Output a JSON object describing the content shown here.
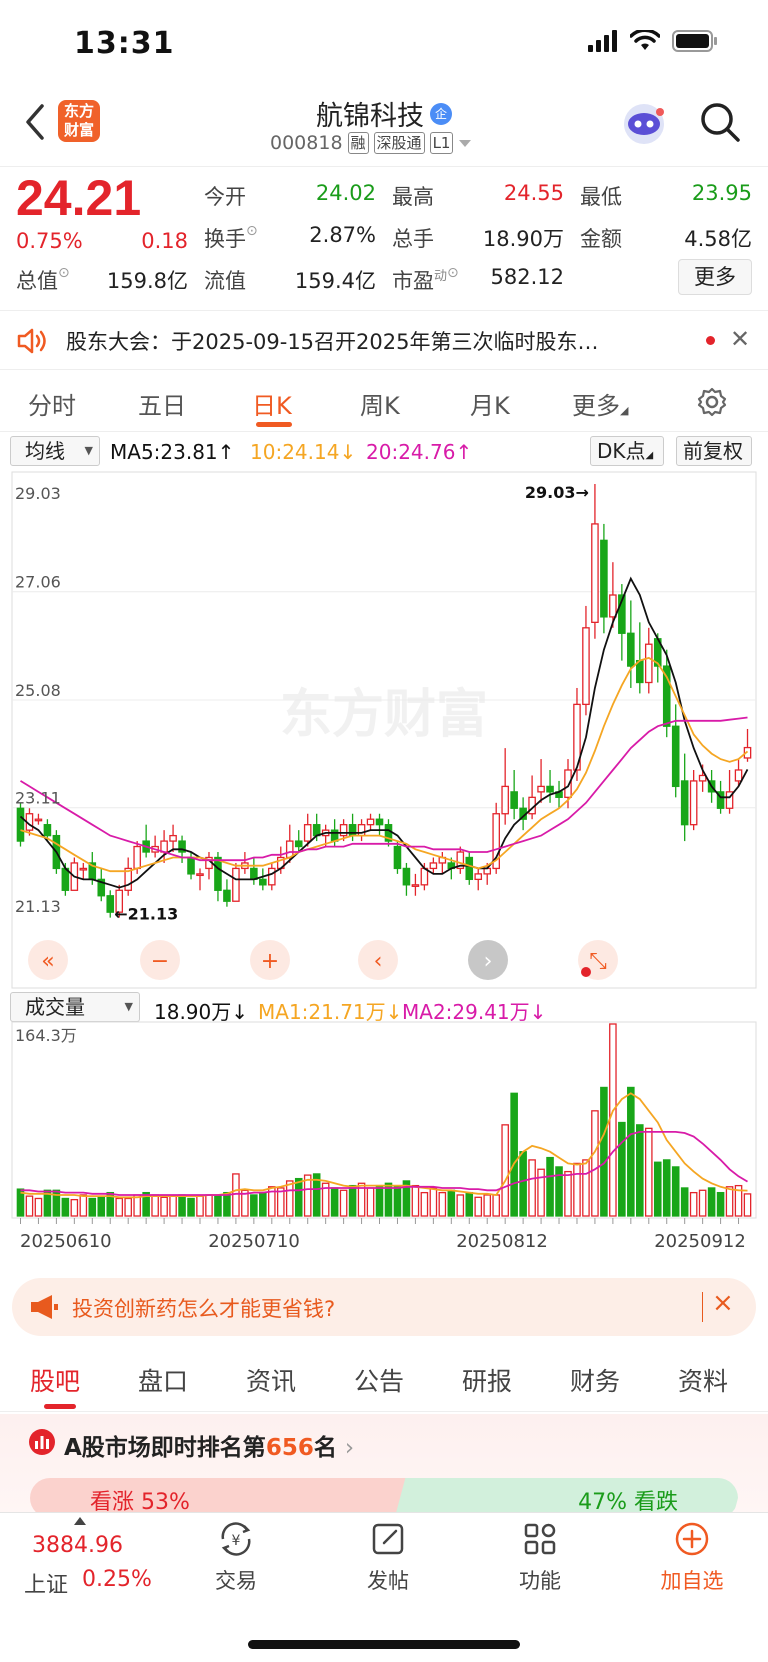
{
  "status": {
    "time": "13:31"
  },
  "header": {
    "logo_text": "东方\n财富",
    "stock_name": "航锦科技",
    "name_badge": "企",
    "code": "000818",
    "tags": [
      "融",
      "深股通",
      "L1"
    ]
  },
  "quote": {
    "price": "24.21",
    "change_pct": "0.75%",
    "change_amt": "0.18",
    "fields": [
      {
        "label": "今开",
        "value": "24.02",
        "color": "#1a9c1a"
      },
      {
        "label": "最高",
        "value": "24.55",
        "color": "#e3242b"
      },
      {
        "label": "最低",
        "value": "23.95",
        "color": "#1a9c1a"
      },
      {
        "label": "换手",
        "value": "2.87%",
        "color": "#222222"
      },
      {
        "label": "总手",
        "value": "18.90万",
        "color": "#222222"
      },
      {
        "label": "金额",
        "value": "4.58亿",
        "color": "#222222"
      },
      {
        "label": "总值",
        "value": "159.8亿",
        "color": "#222222"
      },
      {
        "label": "流值",
        "value": "159.4亿",
        "color": "#222222"
      },
      {
        "label": "市盈",
        "label_sup": "动",
        "value": "582.12",
        "color": "#222222"
      }
    ],
    "more_label": "更多"
  },
  "notice": {
    "text": "股东大会：于2025-09-15召开2025年第三次临时股东…"
  },
  "period_tabs": [
    "分时",
    "五日",
    "日K",
    "周K",
    "月K",
    "更多"
  ],
  "active_period": "日K",
  "ma_bar": {
    "selector": "均线",
    "ma5": "MA5:23.81",
    "ma10": "10:24.14",
    "ma20": "20:24.76",
    "dk_label": "DK点",
    "adjust_label": "前复权"
  },
  "watermark": "东方财富",
  "chart_data": [
    {
      "type": "candlestick",
      "y_ticks": [
        "29.03",
        "27.06",
        "25.08",
        "23.11",
        "21.13"
      ],
      "ylim": [
        21.13,
        29.03
      ],
      "max_label": "29.03",
      "min_label": "21.13",
      "candles": [
        [
          23.1,
          22.5,
          23.2,
          22.4
        ],
        [
          22.7,
          23.0,
          23.1,
          22.6
        ],
        [
          22.9,
          22.9,
          23.0,
          22.8
        ],
        [
          22.8,
          22.6,
          22.9,
          22.5
        ],
        [
          22.6,
          22.0,
          22.7,
          21.9
        ],
        [
          22.0,
          21.6,
          22.1,
          21.5
        ],
        [
          21.6,
          22.1,
          22.2,
          21.6
        ],
        [
          22.0,
          22.0,
          22.1,
          21.8
        ],
        [
          22.1,
          21.8,
          22.3,
          21.7
        ],
        [
          21.8,
          21.5,
          22.0,
          21.4
        ],
        [
          21.5,
          21.2,
          21.6,
          21.1
        ],
        [
          21.2,
          21.6,
          21.7,
          21.1
        ],
        [
          21.6,
          22.0,
          22.2,
          21.5
        ],
        [
          22.0,
          22.4,
          22.5,
          21.9
        ],
        [
          22.5,
          22.3,
          22.8,
          22.2
        ],
        [
          22.3,
          22.4,
          22.6,
          22.2
        ],
        [
          22.3,
          22.5,
          22.7,
          22.1
        ],
        [
          22.5,
          22.6,
          22.8,
          22.3
        ],
        [
          22.5,
          22.3,
          22.6,
          22.1
        ],
        [
          22.2,
          21.9,
          22.3,
          21.8
        ],
        [
          21.9,
          21.9,
          22.0,
          21.6
        ],
        [
          22.0,
          22.2,
          22.3,
          21.8
        ],
        [
          22.2,
          21.6,
          22.3,
          21.4
        ],
        [
          21.6,
          21.4,
          21.8,
          21.3
        ],
        [
          21.4,
          22.0,
          22.1,
          21.4
        ],
        [
          22.0,
          22.1,
          22.3,
          21.9
        ],
        [
          22.0,
          21.8,
          22.2,
          21.7
        ],
        [
          21.8,
          21.7,
          22.0,
          21.6
        ],
        [
          21.7,
          22.0,
          22.1,
          21.6
        ],
        [
          22.0,
          22.2,
          22.4,
          21.9
        ],
        [
          22.2,
          22.5,
          22.8,
          22.1
        ],
        [
          22.5,
          22.4,
          22.7,
          22.3
        ],
        [
          22.5,
          22.8,
          23.0,
          22.4
        ],
        [
          22.8,
          22.6,
          23.0,
          22.5
        ],
        [
          22.6,
          22.7,
          22.8,
          22.4
        ],
        [
          22.7,
          22.5,
          22.9,
          22.4
        ],
        [
          22.6,
          22.8,
          22.9,
          22.5
        ],
        [
          22.8,
          22.6,
          23.0,
          22.5
        ],
        [
          22.6,
          22.8,
          22.9,
          22.5
        ],
        [
          22.8,
          22.9,
          23.0,
          22.7
        ],
        [
          22.9,
          22.8,
          23.0,
          22.6
        ],
        [
          22.8,
          22.5,
          22.9,
          22.4
        ],
        [
          22.4,
          22.0,
          22.5,
          21.9
        ],
        [
          22.0,
          21.7,
          22.1,
          21.5
        ],
        [
          21.7,
          21.7,
          21.9,
          21.5
        ],
        [
          21.7,
          22.0,
          22.1,
          21.6
        ],
        [
          22.0,
          22.1,
          22.2,
          21.9
        ],
        [
          22.1,
          22.2,
          22.3,
          21.9
        ],
        [
          22.1,
          22.0,
          22.2,
          21.8
        ],
        [
          22.0,
          22.3,
          22.4,
          21.9
        ],
        [
          22.2,
          21.8,
          22.3,
          21.7
        ],
        [
          21.8,
          21.9,
          22.0,
          21.6
        ],
        [
          21.9,
          22.0,
          22.1,
          21.7
        ],
        [
          22.0,
          23.0,
          23.2,
          21.9
        ],
        [
          23.0,
          23.5,
          24.2,
          22.8
        ],
        [
          23.4,
          23.1,
          23.8,
          22.9
        ],
        [
          23.1,
          22.9,
          23.3,
          22.7
        ],
        [
          23.0,
          23.3,
          23.7,
          22.9
        ],
        [
          23.4,
          23.5,
          24.0,
          23.2
        ],
        [
          23.5,
          23.4,
          23.8,
          23.2
        ],
        [
          23.4,
          23.3,
          23.6,
          23.1
        ],
        [
          23.3,
          23.8,
          24.0,
          23.1
        ],
        [
          23.8,
          25.0,
          25.3,
          23.6
        ],
        [
          25.0,
          26.4,
          26.8,
          24.8
        ],
        [
          26.5,
          28.3,
          29.03,
          26.2
        ],
        [
          28.0,
          26.6,
          28.3,
          26.3
        ],
        [
          26.6,
          27.0,
          27.6,
          26.4
        ],
        [
          27.0,
          26.3,
          27.2,
          25.8
        ],
        [
          26.3,
          25.7,
          26.9,
          25.3
        ],
        [
          25.8,
          25.4,
          26.5,
          25.2
        ],
        [
          25.4,
          26.1,
          26.4,
          25.2
        ],
        [
          26.2,
          25.7,
          26.3,
          25.4
        ],
        [
          25.7,
          24.6,
          26.0,
          24.4
        ],
        [
          24.6,
          23.5,
          25.0,
          23.3
        ],
        [
          23.6,
          22.8,
          24.1,
          22.5
        ],
        [
          22.8,
          23.6,
          23.8,
          22.7
        ],
        [
          23.6,
          23.7,
          23.9,
          23.4
        ],
        [
          23.6,
          23.4,
          23.8,
          23.2
        ],
        [
          23.4,
          23.1,
          23.6,
          23.0
        ],
        [
          23.1,
          23.4,
          23.8,
          23.0
        ],
        [
          23.6,
          23.8,
          24.0,
          23.5
        ],
        [
          24.02,
          24.21,
          24.55,
          23.95
        ]
      ],
      "ma5": [
        22.95,
        22.8,
        22.7,
        22.5,
        22.3,
        22.0,
        21.85,
        21.8,
        21.8,
        21.75,
        21.7,
        21.65,
        21.7,
        21.8,
        21.95,
        22.1,
        22.25,
        22.35,
        22.35,
        22.3,
        22.2,
        22.15,
        22.0,
        21.9,
        21.8,
        21.8,
        21.8,
        21.85,
        21.9,
        22.0,
        22.15,
        22.3,
        22.45,
        22.6,
        22.65,
        22.65,
        22.65,
        22.65,
        22.65,
        22.7,
        22.7,
        22.7,
        22.6,
        22.4,
        22.2,
        22.0,
        21.9,
        21.9,
        22.0,
        22.05,
        22.05,
        22.0,
        22.0,
        22.2,
        22.55,
        22.8,
        22.95,
        23.1,
        23.25,
        23.35,
        23.4,
        23.5,
        23.85,
        24.4,
        25.3,
        26.0,
        26.5,
        26.9,
        27.3,
        27.0,
        26.5,
        26.2,
        25.9,
        25.4,
        24.7,
        24.2,
        23.8,
        23.5,
        23.3,
        23.3,
        23.5,
        23.81
      ],
      "ma10": [
        22.7,
        22.65,
        22.6,
        22.55,
        22.45,
        22.35,
        22.25,
        22.15,
        22.05,
        22.0,
        21.95,
        21.95,
        21.95,
        22.0,
        22.05,
        22.1,
        22.15,
        22.2,
        22.2,
        22.2,
        22.2,
        22.15,
        22.15,
        22.1,
        22.05,
        22.05,
        22.05,
        22.05,
        22.1,
        22.15,
        22.2,
        22.3,
        22.35,
        22.4,
        22.45,
        22.5,
        22.55,
        22.6,
        22.6,
        22.6,
        22.6,
        22.55,
        22.5,
        22.45,
        22.35,
        22.3,
        22.25,
        22.2,
        22.15,
        22.1,
        22.05,
        22.0,
        22.05,
        22.15,
        22.3,
        22.45,
        22.6,
        22.75,
        22.9,
        23.0,
        23.1,
        23.25,
        23.45,
        23.75,
        24.15,
        24.6,
        25.0,
        25.35,
        25.65,
        25.8,
        25.85,
        25.75,
        25.5,
        25.15,
        24.8,
        24.45,
        24.25,
        24.1,
        24.0,
        23.95,
        24.0,
        24.14
      ],
      "ma20": [
        23.6,
        23.5,
        23.4,
        23.3,
        23.2,
        23.1,
        23.0,
        22.9,
        22.8,
        22.7,
        22.6,
        22.55,
        22.5,
        22.45,
        22.4,
        22.35,
        22.3,
        22.25,
        22.2,
        22.2,
        22.15,
        22.15,
        22.15,
        22.15,
        22.15,
        22.15,
        22.2,
        22.2,
        22.25,
        22.25,
        22.3,
        22.3,
        22.35,
        22.35,
        22.4,
        22.4,
        22.4,
        22.45,
        22.45,
        22.45,
        22.45,
        22.45,
        22.45,
        22.4,
        22.4,
        22.4,
        22.35,
        22.35,
        22.35,
        22.35,
        22.3,
        22.3,
        22.3,
        22.35,
        22.4,
        22.45,
        22.5,
        22.55,
        22.6,
        22.7,
        22.8,
        22.9,
        23.05,
        23.2,
        23.4,
        23.6,
        23.8,
        24.0,
        24.2,
        24.35,
        24.5,
        24.6,
        24.65,
        24.7,
        24.7,
        24.7,
        24.7,
        24.7,
        24.7,
        24.72,
        24.74,
        24.76
      ]
    },
    {
      "type": "bar",
      "title": "成交量",
      "last_vol": "18.90万",
      "ma1": "MA1:21.71万",
      "ma2": "MA2:29.41万",
      "y_max_label": "164.3万",
      "ylim": [
        0,
        164.3
      ],
      "x_labels": [
        "20250610",
        "20250710",
        "20250812",
        "20250912"
      ],
      "volumes": [
        23,
        17,
        15,
        22,
        22,
        15,
        14,
        18,
        15,
        16,
        20,
        15,
        15,
        18,
        20,
        18,
        16,
        17,
        18,
        15,
        17,
        18,
        17,
        20,
        36,
        22,
        18,
        20,
        25,
        24,
        30,
        32,
        35,
        36,
        28,
        24,
        22,
        26,
        28,
        24,
        26,
        28,
        25,
        30,
        26,
        20,
        24,
        20,
        22,
        18,
        20,
        16,
        18,
        18,
        78,
        105,
        55,
        48,
        40,
        50,
        42,
        38,
        45,
        48,
        90,
        110,
        164.3,
        80,
        110,
        78,
        75,
        46,
        48,
        42,
        24,
        20,
        22,
        24,
        20,
        25,
        26,
        18.9
      ],
      "vol_ma1": [
        20,
        19,
        19,
        19,
        18,
        18,
        18,
        17,
        17,
        17,
        17,
        16,
        16,
        16,
        17,
        17,
        17,
        17,
        17,
        17,
        17,
        18,
        18,
        19,
        22,
        23,
        22,
        22,
        24,
        25,
        27,
        29,
        31,
        31,
        30,
        28,
        26,
        25,
        26,
        26,
        26,
        26,
        26,
        26,
        25,
        24,
        23,
        22,
        22,
        21,
        20,
        19,
        19,
        18,
        30,
        45,
        55,
        60,
        58,
        55,
        50,
        45,
        44,
        45,
        55,
        70,
        90,
        100,
        105,
        100,
        90,
        80,
        65,
        55,
        45,
        38,
        32,
        28,
        25,
        23,
        22,
        21.71
      ],
      "vol_ma2": [
        22,
        22,
        21,
        21,
        21,
        20,
        20,
        20,
        19,
        19,
        19,
        18,
        18,
        18,
        18,
        18,
        18,
        18,
        18,
        18,
        18,
        18,
        18,
        18,
        19,
        19,
        20,
        20,
        21,
        21,
        22,
        22,
        23,
        23,
        24,
        24,
        24,
        24,
        24,
        24,
        24,
        24,
        24,
        25,
        25,
        25,
        25,
        24,
        24,
        24,
        23,
        23,
        22,
        22,
        25,
        28,
        30,
        32,
        33,
        34,
        35,
        35,
        36,
        36,
        40,
        45,
        55,
        63,
        70,
        72,
        72,
        72,
        72,
        72,
        71,
        68,
        62,
        55,
        48,
        40,
        34,
        29.41
      ],
      "up_color": "#e3242b",
      "down_color": "#19a619"
    }
  ],
  "chart_controls": [
    "«",
    "−",
    "+",
    "‹",
    "›",
    "⤡"
  ],
  "ad": {
    "text": "投资创新药怎么才能更省钱?",
    "close": "×"
  },
  "section_tabs": [
    "股吧",
    "盘口",
    "资讯",
    "公告",
    "研报",
    "财务",
    "资料"
  ],
  "active_section": "股吧",
  "ranking": {
    "prefix": "A股市场即时排名第",
    "rank": "656",
    "suffix": "名",
    "left_text": "看涨 53%",
    "right_text": "47% 看跌"
  },
  "bottom": {
    "index_value": "3884.96",
    "index_name": "上证",
    "index_change": "0.25%",
    "nav": [
      "交易",
      "发帖",
      "功能",
      "加自选"
    ]
  },
  "colors": {
    "up": "#e3242b",
    "down": "#19a619",
    "accent": "#f05a22",
    "ma5": "#111111",
    "ma10": "#f5a623",
    "ma20": "#d81ba8"
  }
}
